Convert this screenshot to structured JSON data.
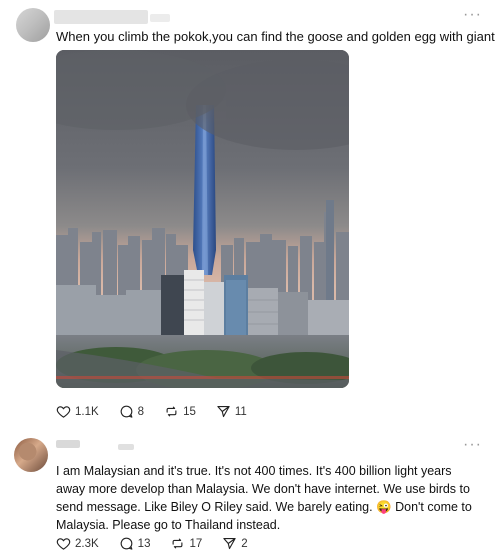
{
  "post": {
    "caption": "When you climb the pokok,you can find the goose and golden egg with giant",
    "more_icon": "more-horizontal-icon",
    "stats": {
      "likes": "1.1K",
      "replies": "8",
      "reposts": "15",
      "shares": "11"
    }
  },
  "comment": {
    "text_before_emoji": "I am Malaysian and it's true. It's not 400 times. It's 400 billion light years away more develop than Malaysia. We don't have internet. We use birds to send message. Like Biley O Riley said. We barely eating. ",
    "emoji": "😜",
    "text_after_emoji": " Don't come to Malaysia. Please go to Thailand instead.",
    "stats": {
      "likes": "2.3K",
      "replies": "13",
      "reposts": "17",
      "shares": "2"
    }
  },
  "colors": {
    "text": "#101010",
    "muted": "#999999",
    "tower": "#3a5d9a"
  }
}
